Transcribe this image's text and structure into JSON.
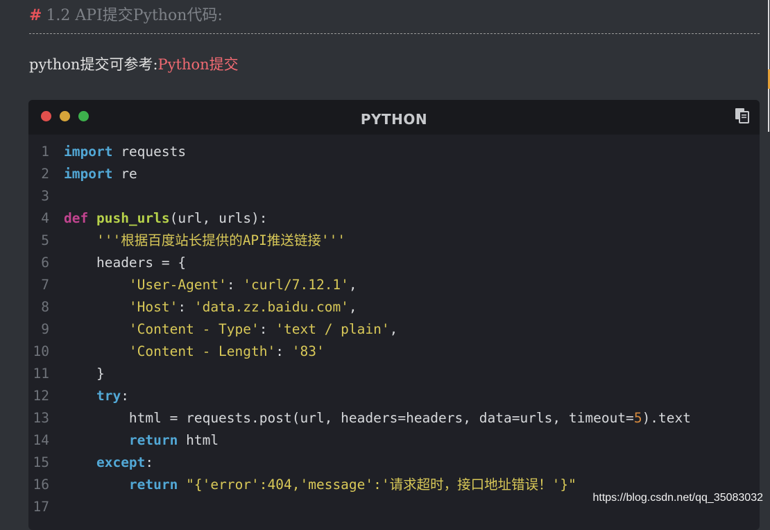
{
  "heading": {
    "hash": "#",
    "text": "1.2 API提交Python代码:"
  },
  "para": {
    "prefix": "python提交可参考:",
    "link": "Python提交"
  },
  "code_block": {
    "language": "PYTHON",
    "lines": [
      {
        "n": "1"
      },
      {
        "n": "2"
      },
      {
        "n": "3"
      },
      {
        "n": "4"
      },
      {
        "n": "5"
      },
      {
        "n": "6"
      },
      {
        "n": "7"
      },
      {
        "n": "8"
      },
      {
        "n": "9"
      },
      {
        "n": "10"
      },
      {
        "n": "11"
      },
      {
        "n": "12"
      },
      {
        "n": "13"
      },
      {
        "n": "14"
      },
      {
        "n": "15"
      },
      {
        "n": "16"
      },
      {
        "n": "17"
      }
    ],
    "t": {
      "import": "import",
      "requests": "requests",
      "re": "re",
      "def": "def",
      "push_urls": "push_urls",
      "args": "(url, urls):",
      "docstring": "'''根据百度站长提供的API推送链接'''",
      "headers_open": "headers = {",
      "ua_key": "'User-Agent'",
      "ua_val": "'curl/7.12.1'",
      "host_key": "'Host'",
      "host_val": "'data.zz.baidu.com'",
      "ct_key": "'Content - Type'",
      "ct_val": "'text / plain'",
      "cl_key": "'Content - Length'",
      "cl_val": "'83'",
      "colon_sep": ": ",
      "comma": ",",
      "close_brace": "}",
      "try": "try",
      "colon": ":",
      "post_prefix": "html = requests.post(url, headers=headers, data=urls, timeout=",
      "timeout": "5",
      "post_suffix": ").text",
      "return": "return",
      "html": " html",
      "except": "except",
      "error_str": "\"{'error':404,'message':'请求超时，接口地址错误！'}\""
    }
  },
  "watermark": "https://blog.csdn.net/qq_35083032"
}
